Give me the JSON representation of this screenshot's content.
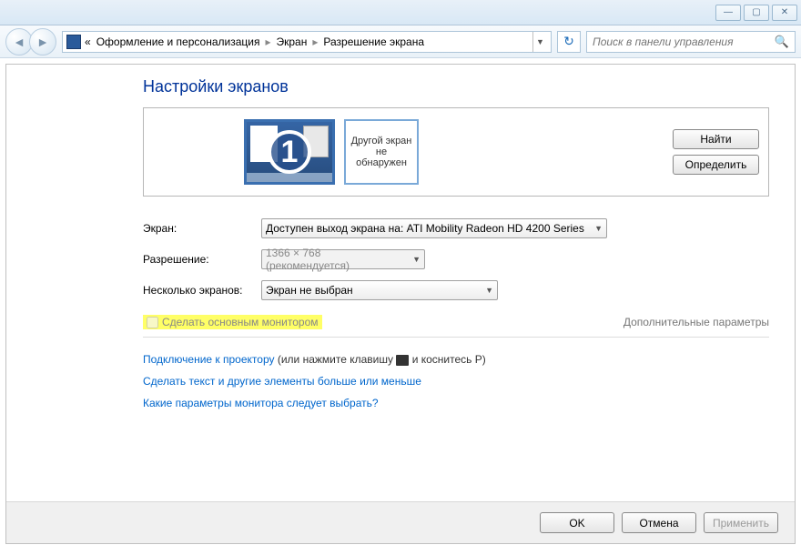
{
  "window": {
    "minimize": "—",
    "maximize": "▢",
    "close": "✕"
  },
  "breadcrumb": {
    "prefix": "«",
    "crumb1": "Оформление и персонализация",
    "crumb2": "Экран",
    "crumb3": "Разрешение экрана",
    "sep": "▸"
  },
  "search": {
    "placeholder": "Поиск в панели управления"
  },
  "page_title": "Настройки экранов",
  "display": {
    "monitor1_number": "1",
    "monitor2_text": "Другой экран не обнаружен",
    "find_btn": "Найти",
    "identify_btn": "Определить"
  },
  "form": {
    "screen_label": "Экран:",
    "screen_value": "Доступен выход экрана на: ATI Mobility Radeon HD 4200 Series",
    "resolution_label": "Разрешение:",
    "resolution_value": "1366 × 768 (рекомендуется)",
    "multi_label": "Несколько экранов:",
    "multi_value": "Экран не выбран"
  },
  "checkbox": {
    "label": "Сделать основным монитором",
    "advanced": "Дополнительные параметры"
  },
  "links": {
    "projector_link": "Подключение к проектору",
    "projector_rest": " (или нажмите клавишу ",
    "projector_end": " и коснитесь P)",
    "text_size": "Сделать текст и другие элементы больше или меньше",
    "which_monitor": "Какие параметры монитора следует выбрать?"
  },
  "buttons": {
    "ok": "OK",
    "cancel": "Отмена",
    "apply": "Применить"
  }
}
